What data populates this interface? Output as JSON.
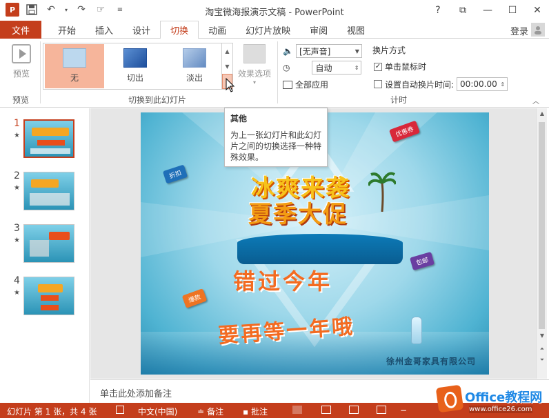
{
  "app": {
    "title": "淘宝微海报演示文稿 - PowerPoint",
    "icon_label": "P",
    "qat_icons": [
      "save-icon",
      "undo-icon",
      "redo-icon",
      "touch-mode-icon",
      "customize-icon"
    ],
    "window_controls": [
      "?",
      "⧉",
      "—",
      "☐",
      "✕"
    ],
    "login": "登录"
  },
  "tabs": {
    "file": "文件",
    "items": [
      "开始",
      "插入",
      "设计",
      "切换",
      "动画",
      "幻灯片放映",
      "审阅",
      "视图"
    ],
    "active": "切换"
  },
  "ribbon": {
    "preview": {
      "button": "预览",
      "group": "预览"
    },
    "transitions": {
      "group": "切换到此幻灯片",
      "items": [
        {
          "label": "无",
          "selected": true
        },
        {
          "label": "切出",
          "selected": false
        },
        {
          "label": "淡出",
          "selected": false
        }
      ],
      "effect_options": "效果选项"
    },
    "timing": {
      "group": "计时",
      "sound": "[无声音]",
      "duration": "自动",
      "apply_all": "全部应用",
      "advance_title": "换片方式",
      "on_click": "单击鼠标时",
      "on_click_checked": true,
      "after_time": "设置自动换片时间:",
      "after_time_checked": false,
      "after_value": "00:00.00"
    }
  },
  "tooltip": {
    "title": "其他",
    "body": "为上一张幻灯片和此幻灯片之间的切换选择一种特殊效果。"
  },
  "slides": [
    {
      "num": "1",
      "star": "★",
      "active": true
    },
    {
      "num": "2",
      "star": "★",
      "active": false
    },
    {
      "num": "3",
      "star": "★",
      "active": false
    },
    {
      "num": "4",
      "star": "★",
      "active": false
    }
  ],
  "slide_content": {
    "headline1": "冰爽来袭",
    "headline2": "夏季大促",
    "line1": "错过今年",
    "line2": "要再等一年哦",
    "company": "徐州金哥家具有限公司",
    "tags": {
      "red": "优惠券",
      "blue": "折扣",
      "purple": "包邮",
      "orange": "爆款"
    }
  },
  "notes": "单击此处添加备注",
  "status": {
    "slide_info": "幻灯片 第 1 张，共 4 张",
    "language": "中文(中国)",
    "notes": "备注",
    "comments": "批注"
  },
  "watermark": {
    "text": "Office教程网",
    "url": "www.office26.com"
  },
  "colors": {
    "accent": "#c43e1c",
    "selected_transition": "#f6b59b"
  }
}
